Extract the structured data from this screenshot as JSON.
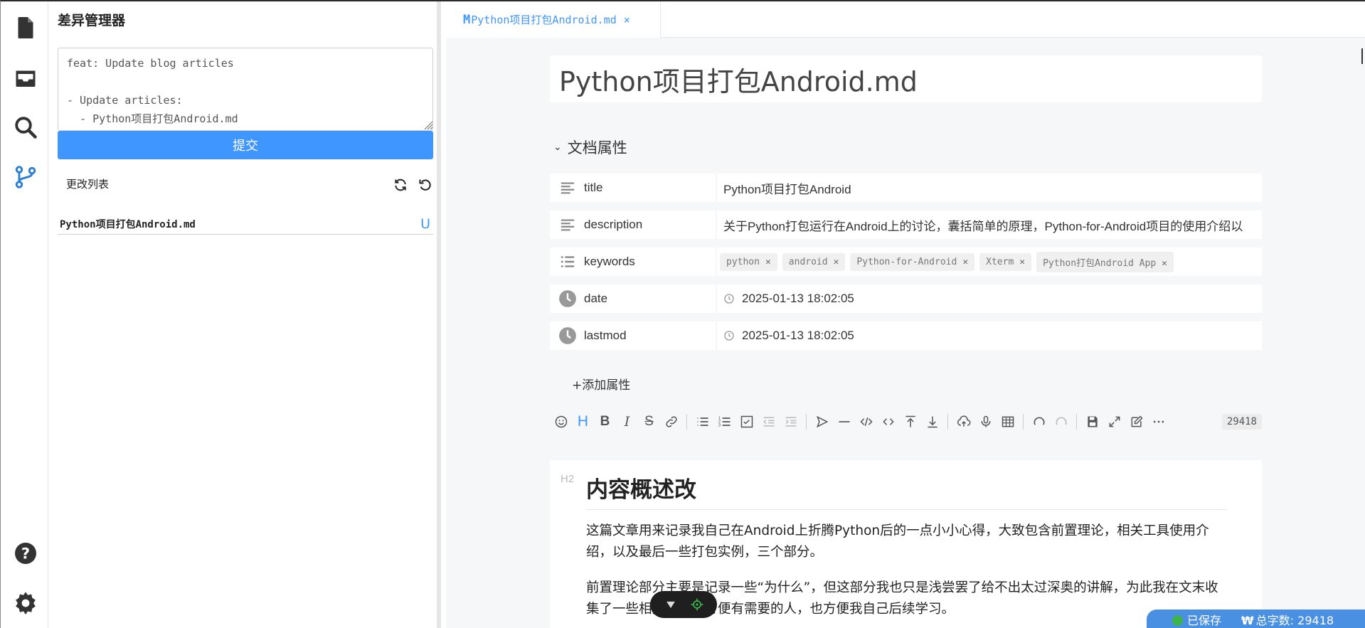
{
  "activity_bar": {
    "items": [
      {
        "name": "file-icon"
      },
      {
        "name": "inbox-icon"
      },
      {
        "name": "search-icon"
      },
      {
        "name": "git-branch-icon"
      }
    ],
    "bottom": [
      {
        "name": "help-icon"
      },
      {
        "name": "settings-icon"
      }
    ],
    "active_color": "#2f7fd3"
  },
  "diff_panel": {
    "title": "差异管理器",
    "commit_message": "feat: Update blog articles\n\n- Update articles:\n  - Python项目打包Android.md",
    "submit_label": "提交",
    "changes_label": "更改列表",
    "files": [
      {
        "name": "Python项目打包Android.md",
        "status": "U"
      }
    ]
  },
  "editor": {
    "tab": {
      "prefix": "M",
      "label": "Python项目打包Android.md",
      "close": "×"
    },
    "doc_title": "Python项目打包Android.md",
    "props_label": "文档属性",
    "properties": [
      {
        "key": "title",
        "icon": "text-icon",
        "value": "Python项目打包Android"
      },
      {
        "key": "description",
        "icon": "text-icon",
        "value": "关于Python打包运行在Android上的讨论，囊括简单的原理，Python-for-Android项目的使用介绍以"
      },
      {
        "key": "keywords",
        "icon": "list-icon",
        "tags": [
          "python",
          "android",
          "Python-for-Android",
          "Xterm",
          "Python打包Android App"
        ]
      },
      {
        "key": "date",
        "icon": "clock-icon",
        "value": "2025-01-13 18:02:05"
      },
      {
        "key": "lastmod",
        "icon": "clock-icon",
        "value": "2025-01-13 18:02:05"
      }
    ],
    "add_property": "+添加属性",
    "word_count_badge": "29418",
    "heading_marker": "H2",
    "heading": "内容概述改",
    "paragraphs": [
      "这篇文章用来记录我自己在Android上折腾Python后的一点小小心得，大致包含前置理论，相关工具使用介绍，以及最后一些打包实例，三个部分。",
      "前置理论部分主要是记录一些“为什么”，但这部分我也只是浅尝罢了给不出太过深奥的讲解，为此我在文末收集了一些相关的链接方便有需要的人，也方便我自己后续学习。"
    ]
  },
  "status_bar": {
    "saved": "已保存",
    "word_count": "总字数: 29418",
    "bg": "#4a90e2"
  }
}
